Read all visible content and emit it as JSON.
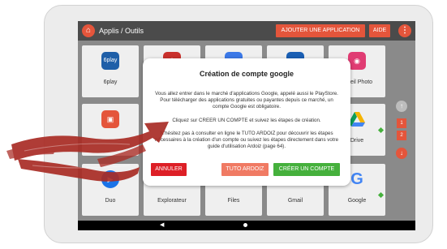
{
  "topbar": {
    "title": "Applis / Outils",
    "add_app_label": "AJOUTER UNE APPLICATION",
    "help_label": "AIDE",
    "home_icon": "home-icon",
    "menu_icon": "more-vert-icon"
  },
  "apps": {
    "row1": [
      "6play",
      "",
      "",
      "",
      "Pareil Photo"
    ],
    "row2": [
      "",
      "",
      "",
      "",
      "Drive"
    ],
    "row3": [
      "Duo",
      "Explorateur",
      "Files",
      "Gmail",
      "Google"
    ],
    "sixplay_logo_text": "6play"
  },
  "pager": {
    "pages": [
      "1",
      "2"
    ],
    "up_icon": "arrow-up-icon",
    "down_icon": "arrow-down-icon"
  },
  "dialog": {
    "title": "Création de compte google",
    "p1": "Vous allez entrer dans le marché d'applications Google, appelé aussi le PlayStore. Pour télécharger des applications gratuites ou payantes depuis ce marché, un compte Google est obligatoire.",
    "p2": "Cliquez sur CREER UN COMPTE et suivez les étapes de création.",
    "p3": "N'hésitez pas à consulter en ligne le TUTO ARDOIZ pour découvrir les étapes nécessaires à la création d'un compte ou suivez les étapes directement dans votre guide d'utilisation Ardoiz (page 64).",
    "cancel_label": "ANNULER",
    "tuto_label": "TUTO ARDOIZ",
    "create_label": "CRÉER UN COMPTE"
  },
  "colors": {
    "accent": "#e4553b",
    "green": "#45b03c",
    "tuto": "#f07a63",
    "arrow": "#a92c25"
  },
  "navbar": {
    "back_icon": "back-triangle-icon",
    "home_icon": "home-dot-icon"
  }
}
